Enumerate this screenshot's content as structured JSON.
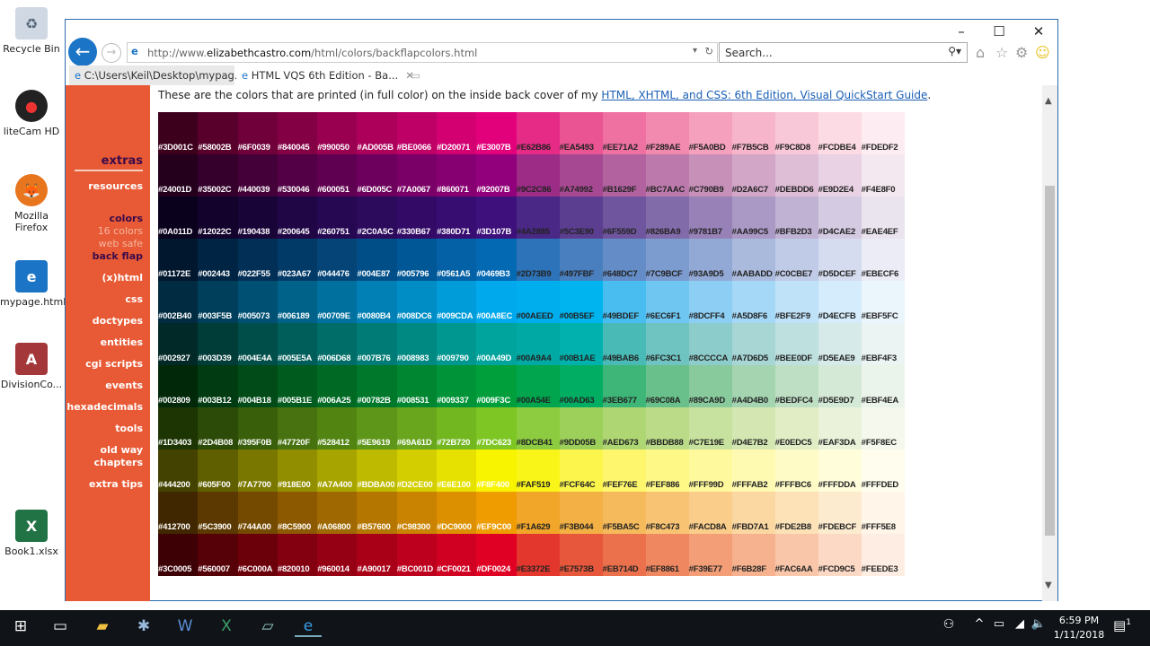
{
  "desktop": {
    "icons": [
      "Recycle Bin",
      "liteCam HD",
      "Mozilla Firefox",
      "mypage.html",
      "DivisionCo...",
      "Book1.xlsx"
    ]
  },
  "browser": {
    "url_prefix": "http://www.",
    "url_domain": "elizabethcastro.com",
    "url_path": "/html/colors/backflapcolors.html",
    "search_placeholder": "Search...",
    "tabs": [
      {
        "label": "C:\\Users\\Keil\\Desktop\\mypag..."
      },
      {
        "label": "HTML VQS 6th Edition - Ba..."
      }
    ]
  },
  "sidebar": {
    "heading": "extras",
    "items": [
      {
        "label": "resources",
        "color": "#ffffff"
      },
      {
        "label": "colors",
        "color": "#3b0a4a"
      },
      {
        "label": "16 colors",
        "color": "#f4b6a0"
      },
      {
        "label": "web safe",
        "color": "#f4b6a0"
      },
      {
        "label": "back flap",
        "color": "#3b0a4a"
      },
      {
        "label": "(x)html",
        "color": "#ffffff"
      },
      {
        "label": "css",
        "color": "#ffffff"
      },
      {
        "label": "doctypes",
        "color": "#ffffff"
      },
      {
        "label": "entities",
        "color": "#ffffff"
      },
      {
        "label": "cgi scripts",
        "color": "#ffffff"
      },
      {
        "label": "events",
        "color": "#ffffff"
      },
      {
        "label": "hexadecimals",
        "color": "#ffffff"
      },
      {
        "label": "tools",
        "color": "#ffffff"
      },
      {
        "label": "old way chapters",
        "color": "#ffffff"
      },
      {
        "label": "extra tips",
        "color": "#ffffff"
      }
    ]
  },
  "main": {
    "intro_text": "These are the colors that are printed (in full color) on the inside back cover of my ",
    "intro_link": "HTML, XHTML, and CSS: 6th Edition, Visual QuickStart Guide",
    "intro_end": "."
  },
  "swatches": [
    [
      "#3D001C",
      "#58002B",
      "#6F0039",
      "#840045",
      "#990050",
      "#AD005B",
      "#BE0066",
      "#D20071",
      "#E3007B",
      "#E62B86",
      "#EA5493",
      "#EE71A2",
      "#F289AE",
      "#F5A0BD",
      "#F7B5CB",
      "#F9C8D8",
      "#FCDBE4",
      "#FDEDF2"
    ],
    [
      "#24001D",
      "#35002C",
      "#440039",
      "#530046",
      "#600051",
      "#6D005C",
      "#7A0067",
      "#860071",
      "#92007B",
      "#9C2C86",
      "#A74992",
      "#B1629F",
      "#BC7AAC",
      "#C790B9",
      "#D2A6C7",
      "#DEBDD6",
      "#E9D2E4",
      "#F4E8F0"
    ],
    [
      "#0A011D",
      "#12022C",
      "#190438",
      "#200645",
      "#260751",
      "#2C0A5C",
      "#330B67",
      "#380D71",
      "#3D107B",
      "#4A2885",
      "#5C3E90",
      "#6F559D",
      "#826BA9",
      "#9781B7",
      "#AA99C5",
      "#BFB2D3",
      "#D4CAE2",
      "#EAE4EF"
    ],
    [
      "#01172E",
      "#002443",
      "#022F55",
      "#023A67",
      "#044476",
      "#004E87",
      "#005796",
      "#0561A5",
      "#0469B3",
      "#2D73B9",
      "#497FBF",
      "#648DC7",
      "#7C9BCF",
      "#93A9D5",
      "#AABADD",
      "#C0CBE7",
      "#D5DCEF",
      "#EBECF6"
    ],
    [
      "#002B40",
      "#003F5B",
      "#005073",
      "#006189",
      "#00709E",
      "#0080B4",
      "#008DC6",
      "#009CDA",
      "#00A8EC",
      "#00AEED",
      "#00B5EF",
      "#49BDEF",
      "#6EC6F1",
      "#8DCFF4",
      "#A5D8F6",
      "#BFE2F9",
      "#D4ECFB",
      "#EBF5FC"
    ],
    [
      "#002927",
      "#003D39",
      "#004E4A",
      "#005E5A",
      "#006D68",
      "#007B76",
      "#008983",
      "#009790",
      "#00A49D",
      "#00A9A4",
      "#00B1AE",
      "#49BAB6",
      "#6FC3C1",
      "#8CCCCA",
      "#A7D6D5",
      "#BEE0DF",
      "#D5EAE9",
      "#EBF4F3"
    ],
    [
      "#002809",
      "#003B12",
      "#004B18",
      "#005B1E",
      "#006A25",
      "#00782B",
      "#008531",
      "#009337",
      "#009F3C",
      "#00A54E",
      "#00AD63",
      "#3EB677",
      "#69C08A",
      "#89CA9D",
      "#A4D4B0",
      "#BEDFC4",
      "#D5E9D7",
      "#EBF4EA"
    ],
    [
      "#1D3403",
      "#2D4B08",
      "#395F0B",
      "#47720F",
      "#528412",
      "#5E9619",
      "#69A61D",
      "#72B720",
      "#7DC623",
      "#8DCB41",
      "#9DD05B",
      "#AED673",
      "#BBDB88",
      "#C7E19E",
      "#D4E7B2",
      "#E0EDC5",
      "#EAF3DA",
      "#F5F8EC"
    ],
    [
      "#444200",
      "#605F00",
      "#7A7700",
      "#918E00",
      "#A7A400",
      "#BDBA00",
      "#D2CE00",
      "#E6E100",
      "#F8F400",
      "#FAF519",
      "#FCF64C",
      "#FEF76E",
      "#FEF886",
      "#FFF99D",
      "#FFFAB2",
      "#FFFBC6",
      "#FFFDDA",
      "#FFFDED"
    ],
    [
      "#412700",
      "#5C3900",
      "#744A00",
      "#8C5900",
      "#A06800",
      "#B57600",
      "#C98300",
      "#DC9000",
      "#EF9C00",
      "#F1A629",
      "#F3B044",
      "#F5BA5C",
      "#F8C473",
      "#FACD8A",
      "#FBD7A1",
      "#FDE2B8",
      "#FDEBCF",
      "#FFF5E8"
    ],
    [
      "#3C0005",
      "#560007",
      "#6C000A",
      "#820010",
      "#960014",
      "#A90017",
      "#BC001D",
      "#CF0021",
      "#DF0024",
      "#E3372E",
      "#E7573B",
      "#EB714D",
      "#EF8861",
      "#F39E77",
      "#F6B28F",
      "#FAC6AA",
      "#FCD9C5",
      "#FEEDE3"
    ]
  ],
  "taskbar": {
    "time": "6:59 PM",
    "date": "1/11/2018",
    "notifications": "1"
  }
}
